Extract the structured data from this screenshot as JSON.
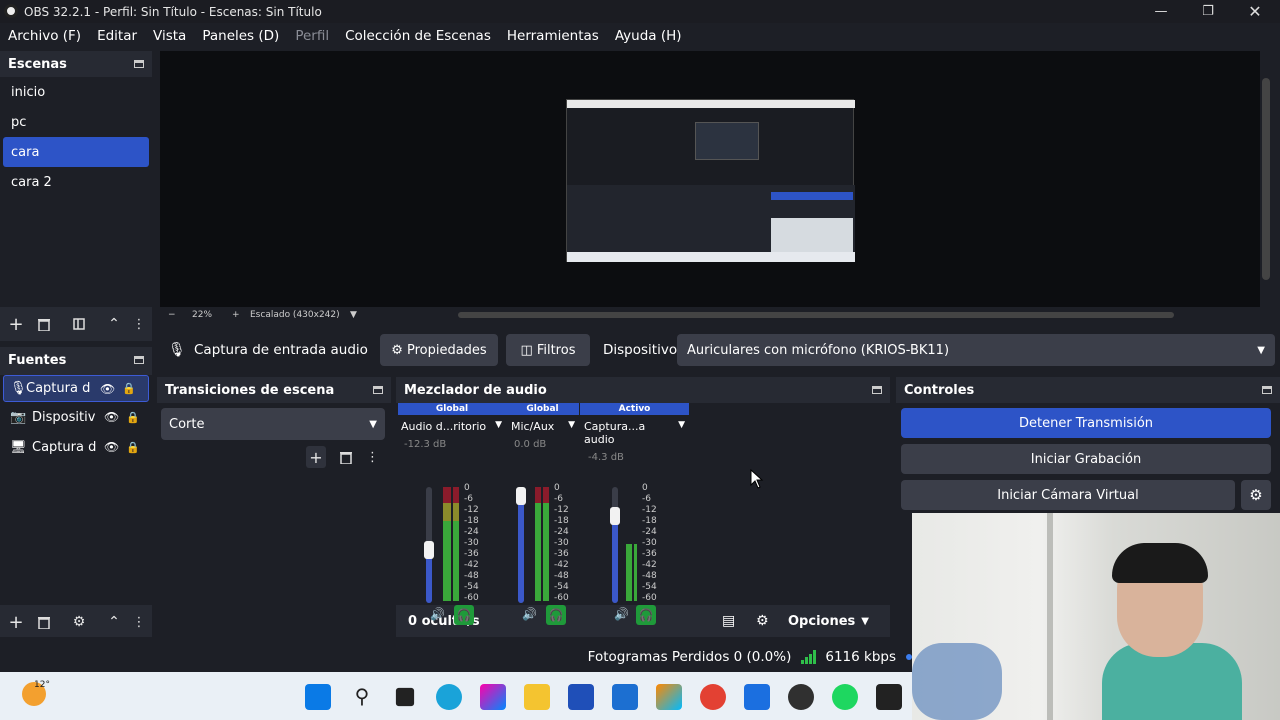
{
  "window": {
    "title": "OBS 32.2.1 - Perfil: Sin Título - Escenas: Sin Título",
    "minimize_icon": "minimize-icon",
    "maximize_icon": "maximize-icon",
    "close_icon": "close-icon"
  },
  "menu": [
    "Archivo (F)",
    "Editar",
    "Vista",
    "Paneles (D)",
    "Perfil",
    "Colección de Escenas",
    "Herramientas",
    "Ayuda (H)"
  ],
  "scenes": {
    "title": "Escenas",
    "items": [
      "inicio",
      "pc",
      "cara",
      "cara 2"
    ],
    "selected": "cara"
  },
  "sources": {
    "title": "Fuentes",
    "items": [
      {
        "label": "Captura d",
        "icon": "microphone-icon"
      },
      {
        "label": "Dispositiv",
        "icon": "camera-icon"
      },
      {
        "label": "Captura d",
        "icon": "monitor-icon"
      }
    ]
  },
  "preview": {
    "zoom": "22%",
    "scaling": "Escalado (430x242)"
  },
  "source_bar": {
    "source_name": "Captura de entrada audio",
    "properties_label": "Propiedades",
    "filters_label": "Filtros",
    "device_label": "Dispositivo",
    "device_value": "Auriculares con micrófono (KRIOS-BK11)"
  },
  "transitions": {
    "title": "Transiciones de escena",
    "selected": "Corte"
  },
  "mixer": {
    "title": "Mezclador de audio",
    "channels": [
      {
        "tag": "Global",
        "name": "Audio d...ritorio",
        "db": "-12.3 dB",
        "level": 0.45
      },
      {
        "tag": "Global",
        "name": "Mic/Aux",
        "db": "0.0 dB",
        "level": 1.0
      },
      {
        "tag": "Activo",
        "name": "Captura...a audio",
        "db": "-4.3 dB",
        "level": 0.8
      }
    ],
    "scale": [
      "0",
      "-6",
      "-12",
      "-18",
      "-24",
      "-30",
      "-36",
      "-42",
      "-48",
      "-54",
      "-60"
    ],
    "hidden": "0 oculto/s",
    "options_label": "Opciones"
  },
  "controls": {
    "title": "Controles",
    "stop_stream": "Detener Transmisión",
    "start_record": "Iniciar Grabación",
    "start_virtual_cam": "Iniciar Cámara Virtual"
  },
  "status": {
    "dropped_frames": "Fotogramas Perdidos 0 (0.0%)",
    "bitrate": "6116 kbps"
  },
  "taskbar": {
    "weather": "12°",
    "accent": "#2d54c7"
  }
}
